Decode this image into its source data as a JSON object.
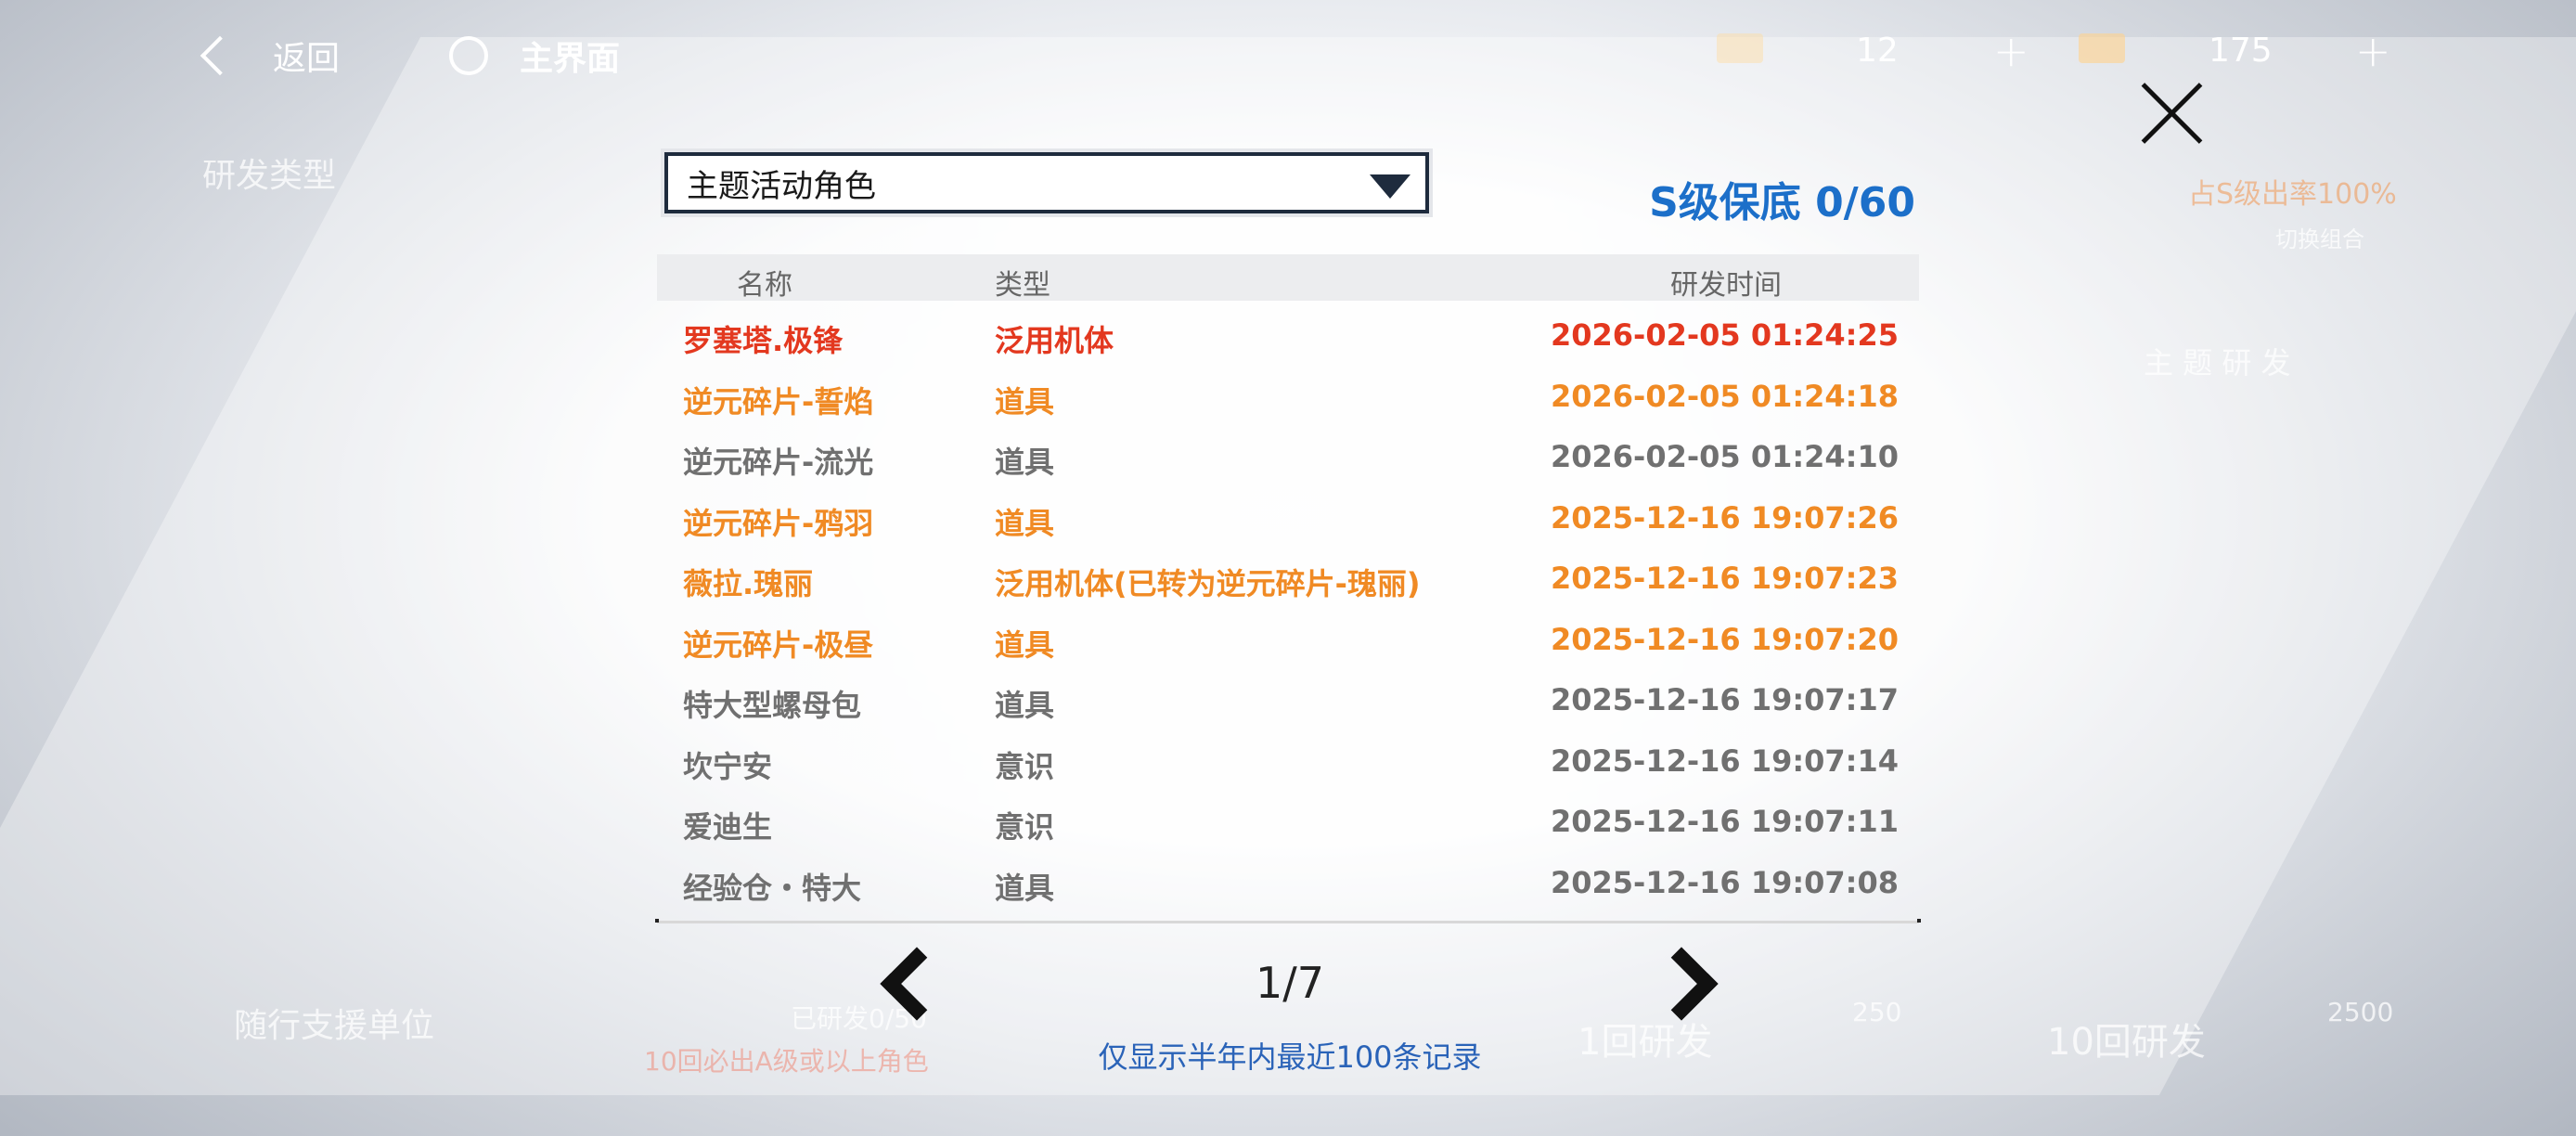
{
  "topbar": {
    "back_label": "返回",
    "home_label": "主界面",
    "resource1_value": "12",
    "resource2_value": "175",
    "plus": "+"
  },
  "background": {
    "research_type": "研发类型",
    "left_button": "随行支援单位",
    "one_pull": "1回研发",
    "ten_pull": "10回研发",
    "cost_one": "250",
    "cost_ten": "2500",
    "theme_research": "主 题 研 发",
    "switch_combo": "切换组合",
    "s_rate": "占S级出率100%",
    "guarantee_line": "10回必出A级或以上角色",
    "researched": "已研发0/50"
  },
  "dialog": {
    "dropdown_label": "主题活动角色",
    "pity_text": "S级保底 0/60",
    "columns": {
      "name": "名称",
      "type": "类型",
      "time": "研发时间"
    },
    "rows": [
      {
        "name": "罗塞塔.极锋",
        "type": "泛用机体",
        "time": "2026-02-05 01:24:25",
        "rarity": "S"
      },
      {
        "name": "逆元碎片-誓焰",
        "type": "道具",
        "time": "2026-02-05 01:24:18",
        "rarity": "A"
      },
      {
        "name": "逆元碎片-流光",
        "type": "道具",
        "time": "2026-02-05 01:24:10",
        "rarity": "B"
      },
      {
        "name": "逆元碎片-鸦羽",
        "type": "道具",
        "time": "2025-12-16 19:07:26",
        "rarity": "A"
      },
      {
        "name": "薇拉.瑰丽",
        "type": "泛用机体(已转为逆元碎片-瑰丽)",
        "time": "2025-12-16 19:07:23",
        "rarity": "A"
      },
      {
        "name": "逆元碎片-极昼",
        "type": "道具",
        "time": "2025-12-16 19:07:20",
        "rarity": "A"
      },
      {
        "name": "特大型螺母包",
        "type": "道具",
        "time": "2025-12-16 19:07:17",
        "rarity": "B"
      },
      {
        "name": "坎宁安",
        "type": "意识",
        "time": "2025-12-16 19:07:14",
        "rarity": "B"
      },
      {
        "name": "爱迪生",
        "type": "意识",
        "time": "2025-12-16 19:07:11",
        "rarity": "B"
      },
      {
        "name": "经验仓・特大",
        "type": "道具",
        "time": "2025-12-16 19:07:08",
        "rarity": "B"
      }
    ],
    "page_indicator": "1/7",
    "note": "仅显示半年内最近100条记录"
  },
  "colors": {
    "S": "#e3381f",
    "A": "#f08a24",
    "B": "#707070",
    "accent_blue": "#1c6fc9"
  }
}
